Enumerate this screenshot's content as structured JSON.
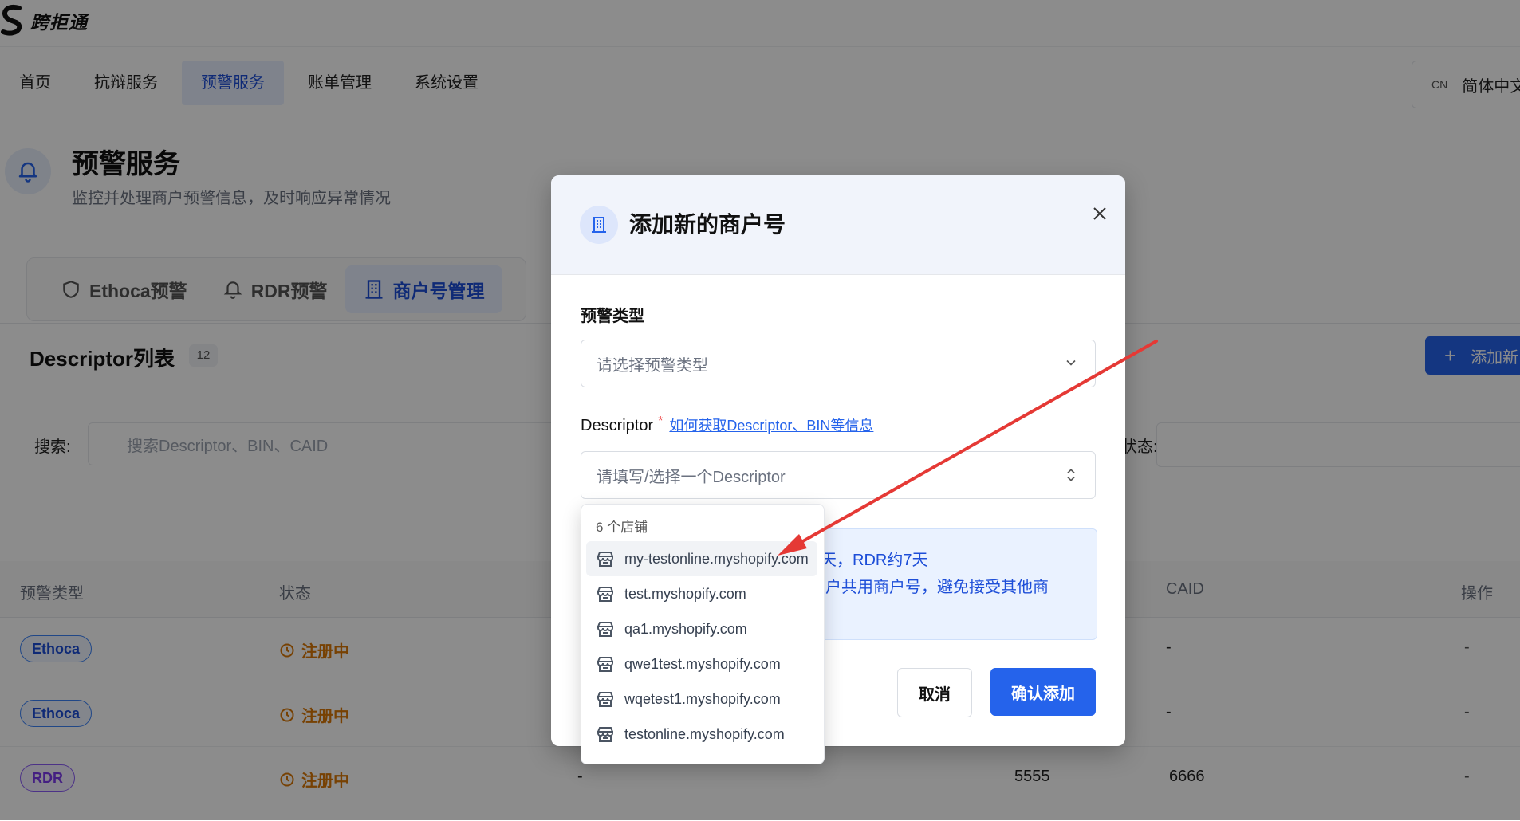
{
  "brand": {
    "name": "跨拒通"
  },
  "nav": {
    "items": [
      "首页",
      "抗辩服务",
      "预警服务",
      "账单管理",
      "系统设置"
    ],
    "active_index": 2,
    "lang_code": "CN",
    "lang_label": "简体中文"
  },
  "page": {
    "title": "预警服务",
    "subtitle": "监控并处理商户预警信息，及时响应异常情况"
  },
  "tabs": [
    "Ethoca预警",
    "RDR预警",
    "商户号管理"
  ],
  "list": {
    "title": "Descriptor列表",
    "count": "12",
    "add_label": "添加新",
    "search_label": "搜索:",
    "search_placeholder": "搜索Descriptor、BIN、CAID",
    "status_label": "状态:"
  },
  "table": {
    "headers": {
      "type": "预警类型",
      "status": "状态",
      "caid": "CAID",
      "ops": "操作"
    },
    "rows": [
      {
        "type": "Ethoca",
        "status": "注册中",
        "bin": "",
        "caid": "-",
        "ops": "-"
      },
      {
        "type": "Ethoca",
        "status": "注册中",
        "bin": "",
        "caid": "-",
        "ops": "-"
      },
      {
        "type": "RDR",
        "status": "注册中",
        "desc": "-",
        "bin": "5555",
        "caid": "6666",
        "ops": "-"
      }
    ]
  },
  "modal": {
    "title": "添加新的商户号",
    "type_label": "预警类型",
    "type_placeholder": "请选择预警类型",
    "descriptor_label": "Descriptor",
    "required_mark": "*",
    "help_link": "如何获取Descriptor、BIN等信息",
    "descriptor_placeholder": "请填写/选择一个Descriptor",
    "info_line1": "天，RDR约7天",
    "info_line2": "商户共用商户号，避免接受其他商",
    "cancel": "取消",
    "confirm": "确认添加"
  },
  "dropdown": {
    "header": "6 个店铺",
    "items": [
      "my-testonline.myshopify.com",
      "test.myshopify.com",
      "qa1.myshopify.com",
      "qwe1test.myshopify.com",
      "wqetest1.myshopify.com",
      "testonline.myshopify.com"
    ]
  },
  "colors": {
    "primary": "#2563eb",
    "warning": "#d97706",
    "annotation_arrow": "#e53935"
  }
}
